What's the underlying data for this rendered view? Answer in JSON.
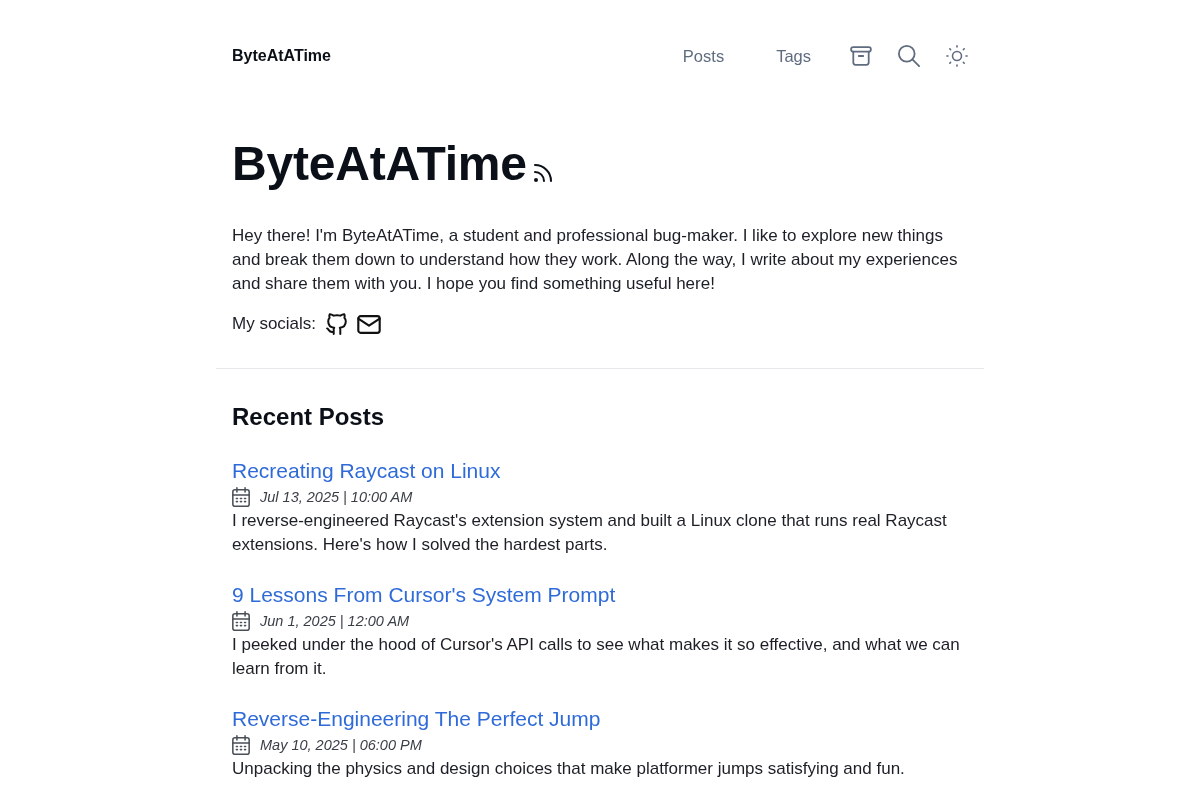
{
  "header": {
    "brand": "ByteAtATime",
    "nav_links": [
      "Posts",
      "Tags"
    ]
  },
  "hero": {
    "title": "ByteAtATime",
    "intro": "Hey there! I'm ByteAtATime, a student and professional bug-maker. I like to explore new things and break them down to understand how they work. Along the way, I write about my experiences and share them with you. I hope you find something useful here!",
    "socials_label": "My socials:"
  },
  "recent_posts": {
    "heading": "Recent Posts",
    "posts": [
      {
        "title": "Recreating Raycast on Linux",
        "date": "Jul 13, 2025 | 10:00 AM",
        "description": "I reverse-engineered Raycast's extension system and built a Linux clone that runs real Raycast extensions. Here's how I solved the hardest parts."
      },
      {
        "title": "9 Lessons From Cursor's System Prompt",
        "date": "Jun 1, 2025 | 12:00 AM",
        "description": "I peeked under the hood of Cursor's API calls to see what makes it so effective, and what we can learn from it."
      },
      {
        "title": "Reverse-Engineering The Perfect Jump",
        "date": "May 10, 2025 | 06:00 PM",
        "description": "Unpacking the physics and design choices that make platformer jumps satisfying and fun."
      }
    ]
  }
}
